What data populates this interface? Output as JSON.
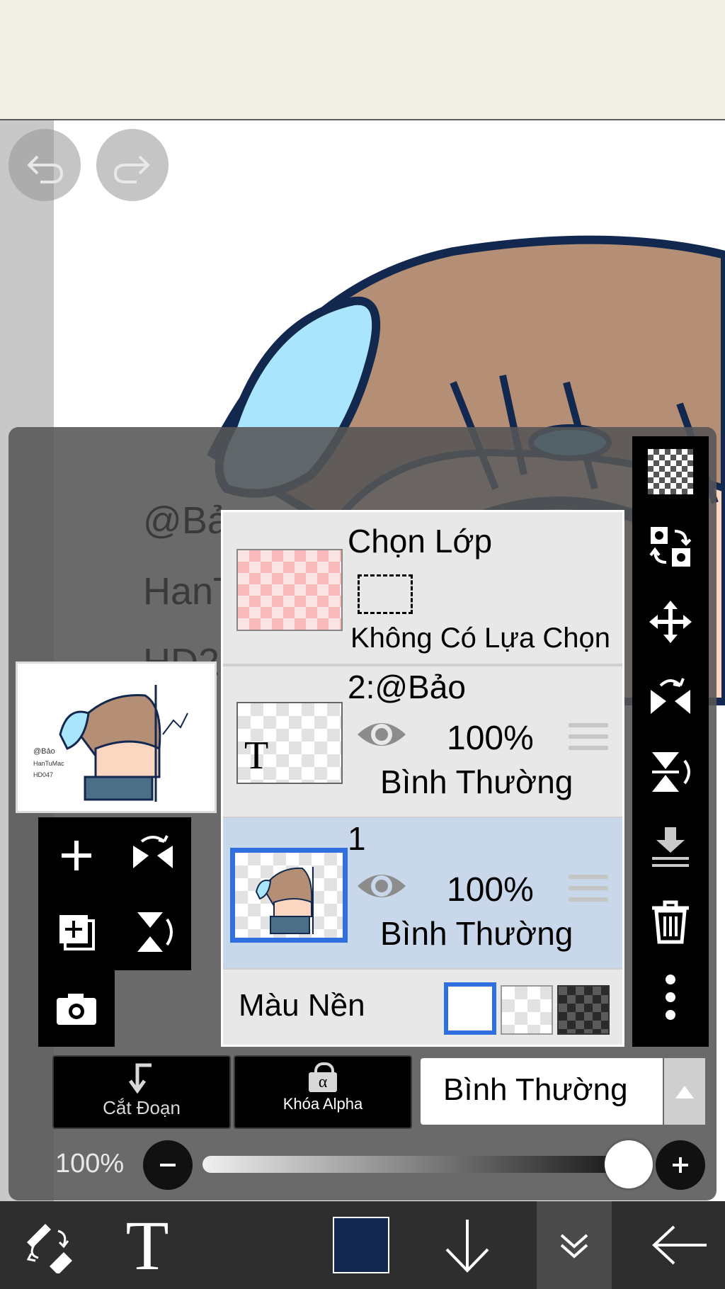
{
  "history": {
    "undo_icon": "undo-icon",
    "redo_icon": "redo-icon"
  },
  "canvas": {
    "ghost_lines": [
      "@Bả",
      "HanT",
      "HD2"
    ],
    "thumbnail_text": [
      "@Bảo",
      "HanTuMac",
      "HD047"
    ]
  },
  "left_tools": {
    "icons": [
      "add-layer-icon",
      "flip-horizontal-icon",
      "add-copy-icon",
      "flip-vertical-icon",
      "camera-icon"
    ]
  },
  "layers": {
    "select_layer": {
      "title": "Chọn Lớp",
      "subtitle": "Không Có Lựa Chọn"
    },
    "items": [
      {
        "name": "2:@Bảo",
        "opacity": "100%",
        "blend": "Bình Thường",
        "thumb_glyph": "T",
        "selected": false
      },
      {
        "name": "1",
        "opacity": "100%",
        "blend": "Bình Thường",
        "selected": true
      }
    ],
    "background": {
      "label": "Màu Nền",
      "options": [
        "white",
        "transparent",
        "dark"
      ],
      "selected": "white"
    }
  },
  "right_toolbar": {
    "icons": [
      "checkerboard-icon",
      "transform-swap-icon",
      "move-icon",
      "flip-horizontal-icon",
      "flip-vertical-icon",
      "merge-down-icon",
      "trash-icon",
      "more-icon"
    ]
  },
  "commands": {
    "clipping": "Cắt Đoạn",
    "alpha_lock": "Khóa Alpha",
    "alpha_glyph": "α",
    "blend_mode": "Bình Thường"
  },
  "opacity": {
    "label": "100%",
    "value": 1.0
  },
  "bottom_bar": {
    "text_glyph": "T",
    "color": "#13284f"
  },
  "colors": {
    "accent_blue": "#2f6fe0",
    "selected_row": "#c9d7ea",
    "panel": "#555555"
  }
}
